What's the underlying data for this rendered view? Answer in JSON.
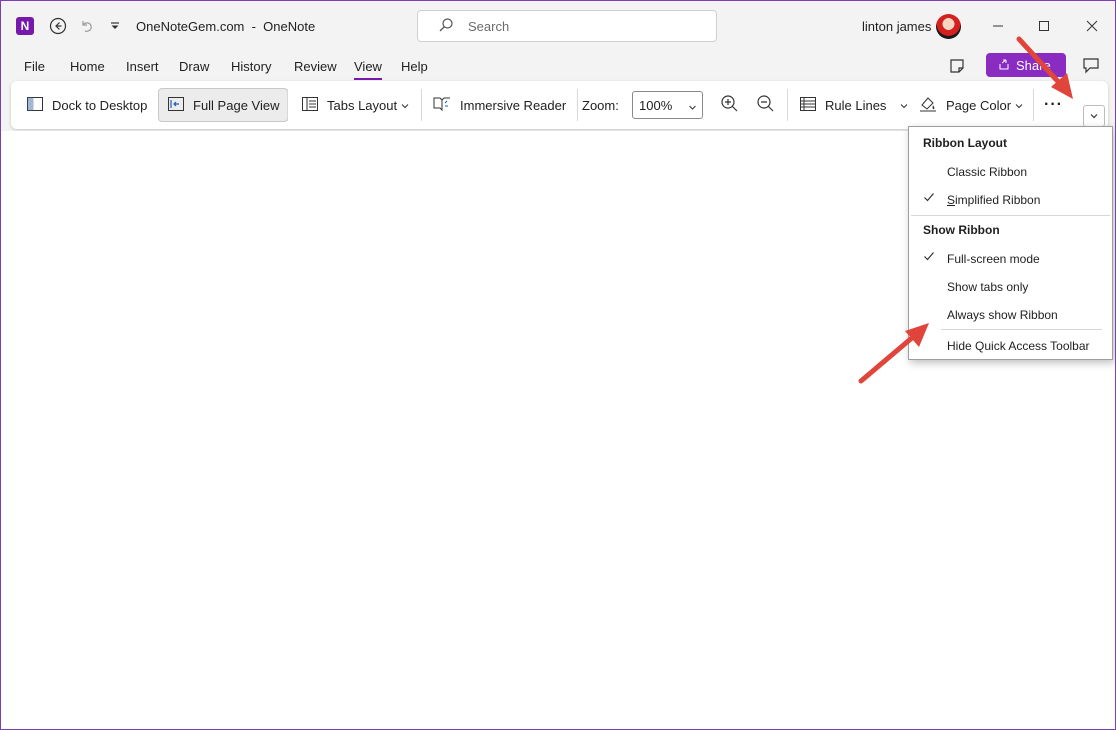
{
  "window": {
    "title": "OneNoteGem.com  -  OneNote",
    "app_icon_letter": "N",
    "search_placeholder": "Search",
    "user_name": "linton james"
  },
  "menu": {
    "tabs": [
      "File",
      "Home",
      "Insert",
      "Draw",
      "History",
      "Review",
      "View",
      "Help"
    ],
    "active_tab": "View",
    "share_label": "Share"
  },
  "ribbon": {
    "dock_to_desktop": "Dock to Desktop",
    "full_page_view": "Full Page View",
    "tabs_layout": "Tabs Layout",
    "immersive_reader": "Immersive Reader",
    "zoom_label": "Zoom:",
    "zoom_value": "100%",
    "rule_lines": "Rule Lines",
    "page_color": "Page Color",
    "more": "···"
  },
  "dropdown": {
    "ribbon_layout_header": "Ribbon Layout",
    "classic_ribbon": "Classic Ribbon",
    "simplified_ribbon": "Simplified Ribbon",
    "show_ribbon_header": "Show Ribbon",
    "full_screen_mode": "Full-screen mode",
    "show_tabs_only": "Show tabs only",
    "always_show_ribbon": "Always show Ribbon",
    "hide_quick_access": "Hide Quick Access Toolbar",
    "checked": [
      "Simplified Ribbon",
      "Full-screen mode"
    ]
  },
  "colors": {
    "accent": "#7719aa",
    "share": "#8a2bc2",
    "annotation_arrow": "#e0443a"
  }
}
